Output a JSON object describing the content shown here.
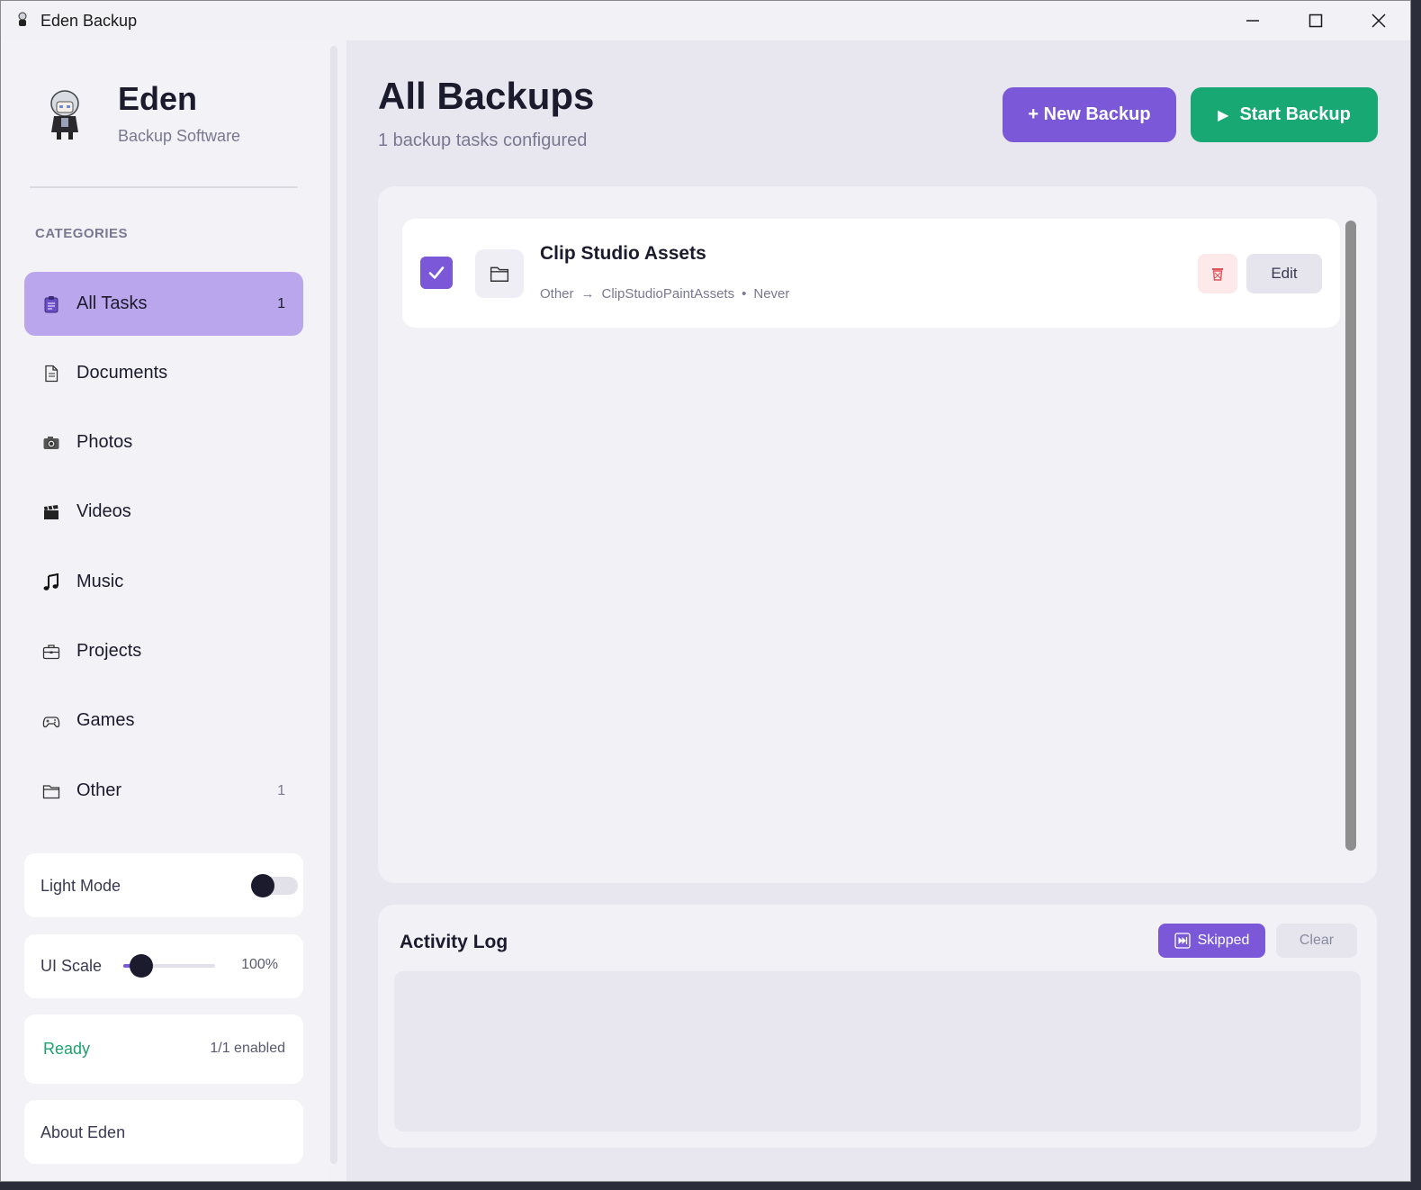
{
  "window": {
    "title": "Eden Backup",
    "icons": {
      "app": "eden-app-icon",
      "minimize": "minimize-icon",
      "maximize": "maximize-icon",
      "close": "close-icon"
    }
  },
  "sidebar": {
    "brand_name": "Eden",
    "brand_subtitle": "Backup Software",
    "categories_heading": "CATEGORIES",
    "items": [
      {
        "label": "All Tasks",
        "count": "1",
        "icon": "clipboard-icon",
        "active": true
      },
      {
        "label": "Documents",
        "count": "",
        "icon": "document-icon",
        "active": false
      },
      {
        "label": "Photos",
        "count": "",
        "icon": "camera-icon",
        "active": false
      },
      {
        "label": "Videos",
        "count": "",
        "icon": "clapperboard-icon",
        "active": false
      },
      {
        "label": "Music",
        "count": "",
        "icon": "music-note-icon",
        "active": false
      },
      {
        "label": "Projects",
        "count": "",
        "icon": "briefcase-icon",
        "active": false
      },
      {
        "label": "Games",
        "count": "",
        "icon": "gamepad-icon",
        "active": false
      },
      {
        "label": "Other",
        "count": "1",
        "icon": "folder-icon",
        "active": false
      }
    ],
    "light_mode": {
      "label": "Light Mode",
      "enabled": false
    },
    "ui_scale": {
      "label": "UI Scale",
      "value": "100%",
      "level": 0.2
    },
    "status": {
      "state": "Ready",
      "enabled_text": "1/1 enabled"
    },
    "about_label": "About Eden"
  },
  "main": {
    "title": "All Backups",
    "subtitle": "1 backup tasks configured",
    "new_backup_label": "+ New Backup",
    "start_backup_label": "Start Backup",
    "tasks": [
      {
        "name": "Clip Studio Assets",
        "category": "Other",
        "arrow": "→",
        "destination": "ClipStudioPaintAssets",
        "separator": "•",
        "last_run": "Never",
        "checked": true,
        "edit_label": "Edit"
      }
    ],
    "activity_log": {
      "title": "Activity Log",
      "skipped_label": "Skipped",
      "clear_label": "Clear"
    }
  },
  "colors": {
    "accent": "#7a58d8",
    "accent_light": "#b9a6ec",
    "success": "#18a874",
    "status_ready": "#1fa06e",
    "delete_bg": "#fde8ea",
    "delete_icon": "#e0525a"
  }
}
